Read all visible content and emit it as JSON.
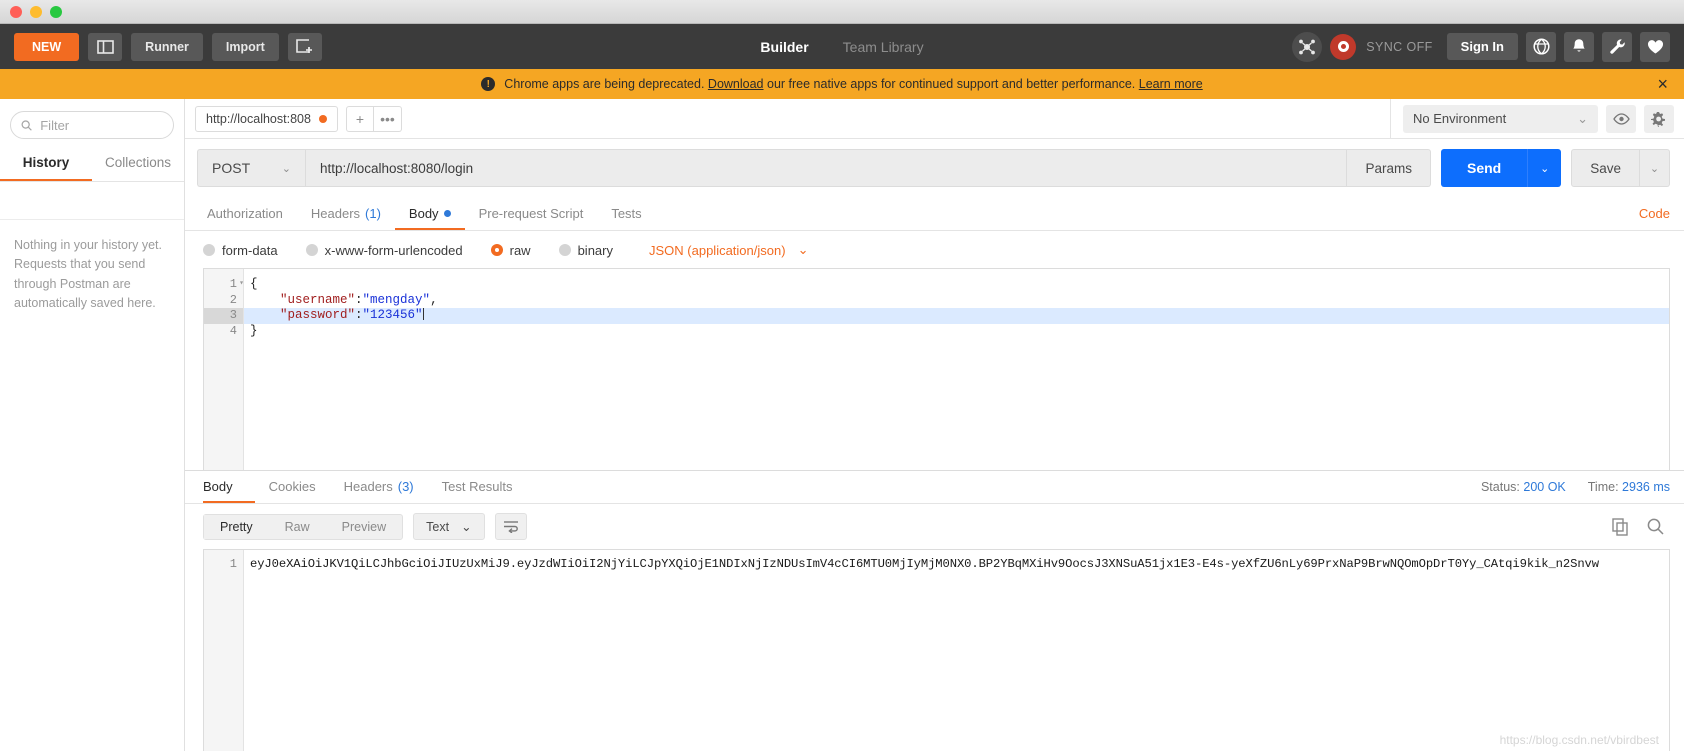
{
  "window": {
    "traffic_lights": [
      "close",
      "minimize",
      "maximize"
    ]
  },
  "appbar": {
    "new_label": "NEW",
    "sidebar_toggle_icon": "panel-layout-icon",
    "runner_label": "Runner",
    "import_label": "Import",
    "new_window_icon": "new-window-icon",
    "tabs": [
      {
        "label": "Builder",
        "active": true
      },
      {
        "label": "Team Library",
        "active": false
      }
    ],
    "interceptor_icon": "interceptor-icon",
    "sync_icon": "sync-icon",
    "sync_label": "SYNC OFF",
    "signin_label": "Sign In",
    "globe_icon": "globe-icon",
    "bell_icon": "bell-icon",
    "wrench_icon": "wrench-icon",
    "heart_icon": "heart-icon"
  },
  "banner": {
    "icon": "alert-icon",
    "text_before": "Chrome apps are being deprecated.",
    "link1": "Download",
    "text_middle": "our free native apps for continued support and better performance.",
    "link2": "Learn more",
    "close_icon": "close-icon"
  },
  "sidebar": {
    "filter_placeholder": "Filter",
    "search_icon": "search-icon",
    "tabs": [
      {
        "label": "History",
        "active": true
      },
      {
        "label": "Collections",
        "active": false
      }
    ],
    "empty_message": "Nothing in your history yet. Requests that you send through Postman are automatically saved here."
  },
  "request_tabs": {
    "open_tab_label": "http://localhost:808",
    "unsaved_indicator": "orange-dot",
    "add_icon": "plus-icon",
    "more_icon": "ellipsis-icon"
  },
  "environment": {
    "selected": "No Environment",
    "chevron_icon": "chevron-down-icon",
    "eye_icon": "eye-icon",
    "gear_icon": "gear-icon"
  },
  "url_bar": {
    "method": "POST",
    "method_chevron": "chevron-down-icon",
    "url": "http://localhost:8080/login",
    "params_label": "Params",
    "send_label": "Send",
    "send_chevron": "chevron-down-icon",
    "save_label": "Save",
    "save_chevron": "chevron-down-icon"
  },
  "request_tabs_row": {
    "tabs": [
      {
        "label": "Authorization",
        "active": false,
        "count": null,
        "dot": false
      },
      {
        "label": "Headers",
        "active": false,
        "count": "(1)",
        "dot": false
      },
      {
        "label": "Body",
        "active": true,
        "count": null,
        "dot": true
      },
      {
        "label": "Pre-request Script",
        "active": false,
        "count": null,
        "dot": false
      },
      {
        "label": "Tests",
        "active": false,
        "count": null,
        "dot": false
      }
    ],
    "code_label": "Code"
  },
  "body_types": {
    "options": [
      {
        "label": "form-data",
        "selected": false
      },
      {
        "label": "x-www-form-urlencoded",
        "selected": false
      },
      {
        "label": "raw",
        "selected": true
      },
      {
        "label": "binary",
        "selected": false
      }
    ],
    "content_type": "JSON (application/json)",
    "content_type_chevron": "chevron-down-icon"
  },
  "request_body": {
    "lines": [
      {
        "num": "1",
        "fold": true,
        "highlight": false,
        "segments": [
          {
            "t": "{",
            "c": "p"
          }
        ]
      },
      {
        "num": "2",
        "fold": false,
        "highlight": false,
        "segments": [
          {
            "t": "    ",
            "c": "p"
          },
          {
            "t": "\"username\"",
            "c": "k"
          },
          {
            "t": ":",
            "c": "p"
          },
          {
            "t": "\"mengday\"",
            "c": "v"
          },
          {
            "t": ",",
            "c": "p"
          }
        ]
      },
      {
        "num": "3",
        "fold": false,
        "highlight": true,
        "segments": [
          {
            "t": "    ",
            "c": "p"
          },
          {
            "t": "\"password\"",
            "c": "k"
          },
          {
            "t": ":",
            "c": "p"
          },
          {
            "t": "\"123456\"",
            "c": "v"
          }
        ]
      },
      {
        "num": "4",
        "fold": false,
        "highlight": false,
        "segments": [
          {
            "t": "}",
            "c": "p"
          }
        ]
      }
    ]
  },
  "response": {
    "tabs": [
      {
        "label": "Body",
        "active": true,
        "count": null
      },
      {
        "label": "Cookies",
        "active": false,
        "count": null
      },
      {
        "label": "Headers",
        "active": false,
        "count": "(3)"
      },
      {
        "label": "Test Results",
        "active": false,
        "count": null
      }
    ],
    "status_label": "Status:",
    "status_value": "200 OK",
    "time_label": "Time:",
    "time_value": "2936 ms",
    "view_modes": [
      {
        "label": "Pretty",
        "active": true
      },
      {
        "label": "Raw",
        "active": false
      },
      {
        "label": "Preview",
        "active": false
      }
    ],
    "format": "Text",
    "format_chevron": "chevron-down-icon",
    "wrap_icon": "word-wrap-icon",
    "copy_icon": "copy-icon",
    "search_icon": "search-icon",
    "line_number": "1",
    "body_text": "eyJ0eXAiOiJKV1QiLCJhbGciOiJIUzUxMiJ9.eyJzdWIiOiI2NjYiLCJpYXQiOjE1NDIxNjIzNDUsImV4cCI6MTU0MjIyMjM0NX0.BP2YBqMXiHv9OocsJ3XNSuA51jx1E3-E4s-yeXfZU6nLy69PrxNaP9BrwNQOmOpDrT0Yy_CAtqi9kik_n2Snvw"
  },
  "watermark": "https://blog.csdn.net/vbirdbest",
  "colors": {
    "brand_orange": "#f26b21",
    "banner_orange": "#f5a623",
    "send_blue": "#0d6efd",
    "link_blue": "#2e79d8",
    "dark_header": "#3b3b3b"
  }
}
